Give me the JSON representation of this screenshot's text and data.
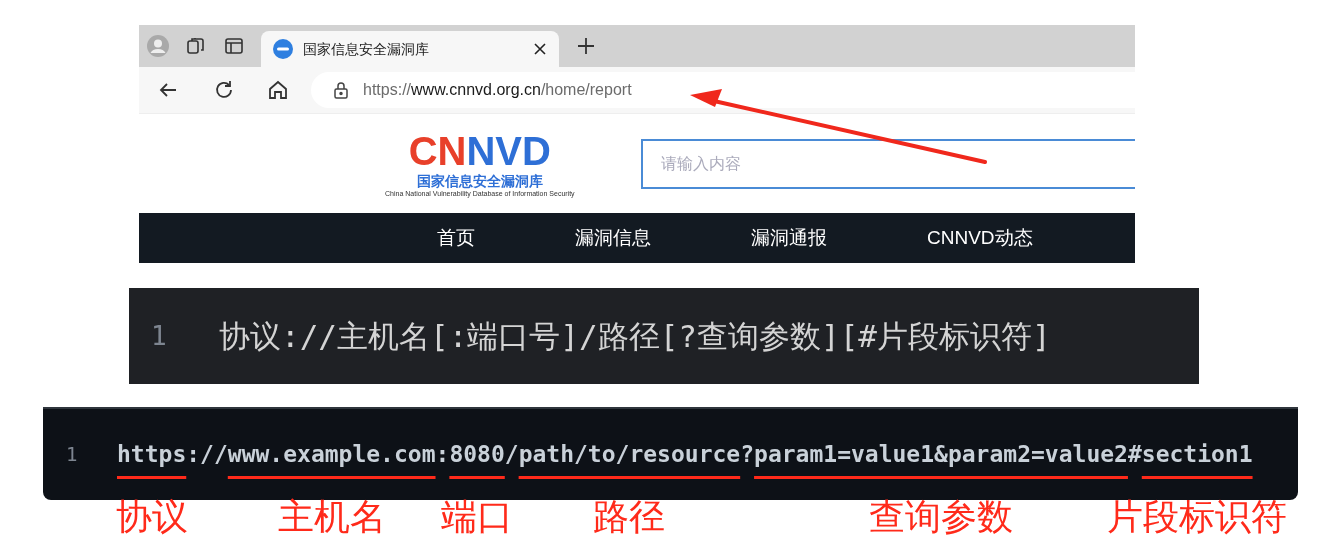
{
  "browser": {
    "tabs": [
      {
        "title": "国家信息安全漏洞库",
        "selected": true
      }
    ],
    "url": {
      "scheme": "https://",
      "host": "www.cnnvd.org.cn",
      "path": "/home/report"
    },
    "site": {
      "logo_left": "CN",
      "logo_right": "NVD",
      "logo_subtitle": "国家信息安全漏洞库",
      "logo_caption": "China National Vulnerability Database of Information Security",
      "search": {
        "placeholder": "请输入内容"
      },
      "nav": [
        {
          "label": "首页"
        },
        {
          "label": "漏洞信息"
        },
        {
          "label": "漏洞通报"
        },
        {
          "label": "CNNVD动态"
        }
      ]
    }
  },
  "syntax_block": {
    "line_number": "1",
    "code": "协议://主机名[:端口号]/路径[?查询参数][#片段标识符]"
  },
  "example_block": {
    "line_number": "1",
    "segments": [
      {
        "text": "https",
        "label": "协议"
      },
      {
        "text": "://"
      },
      {
        "text": "www.example.com",
        "label": "主机名"
      },
      {
        "text": ":"
      },
      {
        "text": "8080",
        "label": "端口"
      },
      {
        "text": "/"
      },
      {
        "text": "path/to/resource",
        "label": "路径"
      },
      {
        "text": "?"
      },
      {
        "text": "param1=value1&param2=value2",
        "label": "查询参数"
      },
      {
        "text": "#"
      },
      {
        "text": "section1",
        "label": "片段标识符"
      }
    ]
  }
}
